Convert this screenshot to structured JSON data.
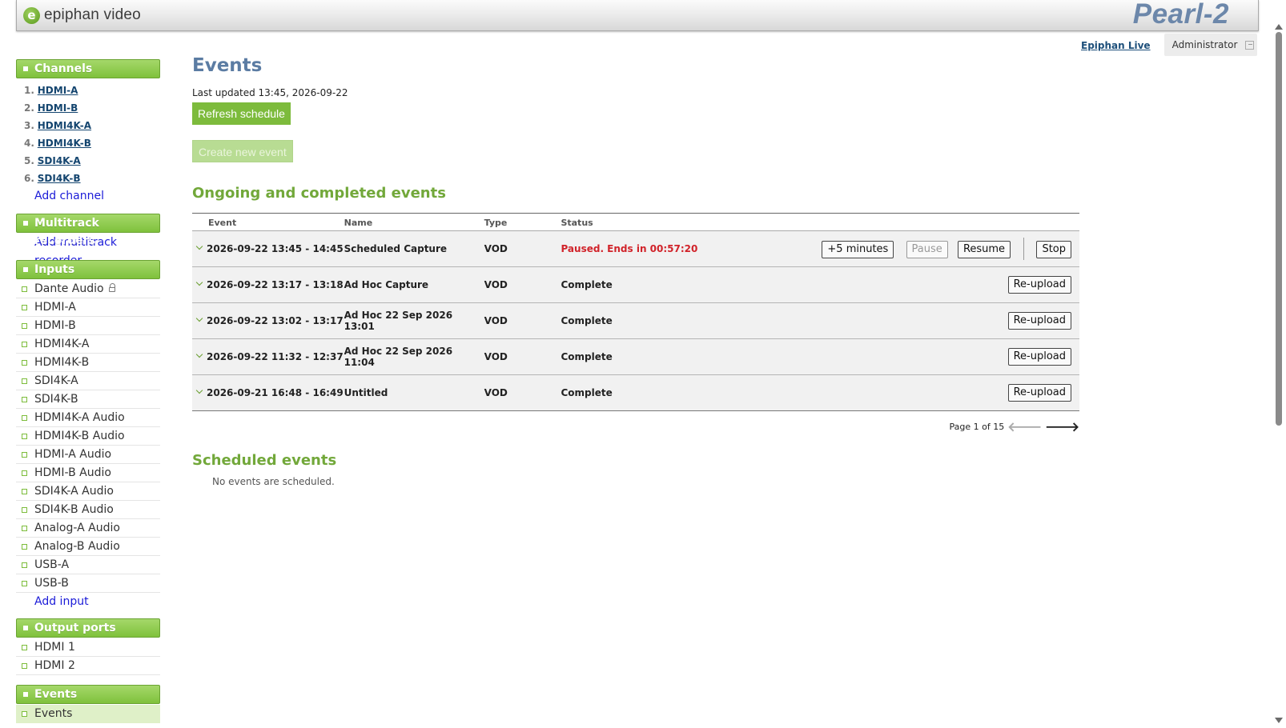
{
  "header": {
    "brand": "epiphan video",
    "brand_logo_letter": "e",
    "product": "Pearl-2"
  },
  "top": {
    "live_link": "Epiphan Live",
    "admin": "Administrator"
  },
  "sidebar": {
    "channels_title": "Channels",
    "channels": [
      {
        "num": "1.",
        "label": "HDMI-A"
      },
      {
        "num": "2.",
        "label": "HDMI-B"
      },
      {
        "num": "3.",
        "label": "HDMI4K-A"
      },
      {
        "num": "4.",
        "label": "HDMI4K-B"
      },
      {
        "num": "5.",
        "label": "SDI4K-A"
      },
      {
        "num": "6.",
        "label": "SDI4K-B"
      }
    ],
    "add_channel": "Add channel",
    "multitrack_title": "Multitrack recorders",
    "add_multitrack": "Add multitrack recorder",
    "inputs_title": "Inputs",
    "inputs": [
      "Dante Audio",
      "HDMI-A",
      "HDMI-B",
      "HDMI4K-A",
      "HDMI4K-B",
      "SDI4K-A",
      "SDI4K-B",
      "HDMI4K-A Audio",
      "HDMI4K-B Audio",
      "HDMI-A Audio",
      "HDMI-B Audio",
      "SDI4K-A Audio",
      "SDI4K-B Audio",
      "Analog-A Audio",
      "Analog-B Audio",
      "USB-A",
      "USB-B"
    ],
    "add_input": "Add input",
    "outputs_title": "Output ports",
    "outputs": [
      "HDMI 1",
      "HDMI 2"
    ],
    "events_title": "Events",
    "events_items": [
      "Events"
    ]
  },
  "main": {
    "title": "Events",
    "last_updated": "Last updated 13:45, 2026-09-22",
    "refresh_btn": "Refresh schedule",
    "create_btn": "Create new event",
    "ongoing_title": "Ongoing and completed events",
    "columns": {
      "event": "Event",
      "name": "Name",
      "type": "Type",
      "status": "Status"
    },
    "rows": [
      {
        "event": "2026-09-22 13:45 - 14:45",
        "name": "Scheduled Capture",
        "type": "VOD",
        "status": "Paused. Ends in 00:57:20"
      },
      {
        "event": "2026-09-22 13:17 - 13:18",
        "name": "Ad Hoc Capture",
        "type": "VOD",
        "status": "Complete"
      },
      {
        "event": "2026-09-22 13:02 - 13:17",
        "name": "Ad Hoc 22 Sep 2026 13:01",
        "type": "VOD",
        "status": "Complete"
      },
      {
        "event": "2026-09-22 11:32 - 12:37",
        "name": "Ad Hoc 22 Sep 2026 11:04",
        "type": "VOD",
        "status": "Complete"
      },
      {
        "event": "2026-09-21 16:48 - 16:49",
        "name": "Untitled",
        "type": "VOD",
        "status": "Complete"
      }
    ],
    "actions": {
      "plus5": "+5 minutes",
      "pause": "Pause",
      "resume": "Resume",
      "stop": "Stop",
      "reupload": "Re-upload"
    },
    "pager": "Page 1 of 15",
    "pager_prev": "🡐",
    "pager_next": "🡒",
    "scheduled_title": "Scheduled events",
    "no_events": "No events are scheduled."
  },
  "colors": {
    "accent_green": "#7dbb3c",
    "title_blue": "#5b7ca3",
    "status_red": "#d1232a"
  }
}
